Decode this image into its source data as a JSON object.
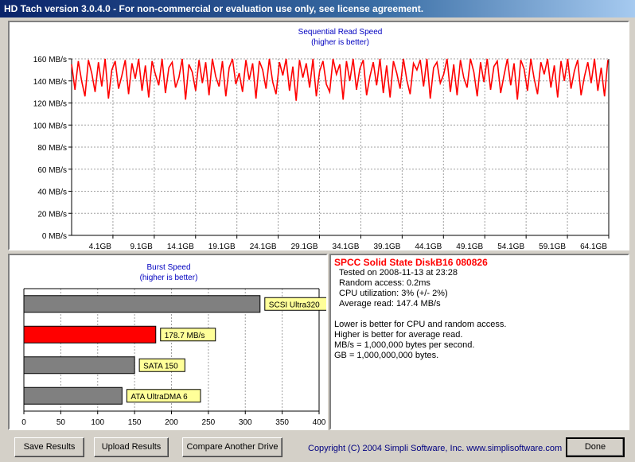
{
  "window": {
    "title": "HD Tach version 3.0.4.0  - For non-commercial or evaluation use only, see license agreement."
  },
  "seq_chart": {
    "title_line1": "Sequential Read Speed",
    "title_line2": "(higher is better)",
    "y_ticks": [
      "0 MB/s",
      "20 MB/s",
      "40 MB/s",
      "60 MB/s",
      "80 MB/s",
      "100 MB/s",
      "120 MB/s",
      "140 MB/s",
      "160 MB/s"
    ],
    "x_ticks": [
      "4.1GB",
      "9.1GB",
      "14.1GB",
      "19.1GB",
      "24.1GB",
      "29.1GB",
      "34.1GB",
      "39.1GB",
      "44.1GB",
      "49.1GB",
      "54.1GB",
      "59.1GB",
      "64.1GB"
    ],
    "line_color": "#ff0000"
  },
  "burst_chart": {
    "title_line1": "Burst Speed",
    "title_line2": "(higher is better)",
    "x_ticks": [
      "0",
      "50",
      "100",
      "150",
      "200",
      "250",
      "300",
      "350",
      "400"
    ]
  },
  "chart_data": [
    {
      "type": "line",
      "title": "Sequential Read Speed",
      "subtitle": "(higher is better)",
      "xlabel": "",
      "ylabel": "",
      "x_unit": "GB",
      "y_unit": "MB/s",
      "xlim": [
        0,
        64.1
      ],
      "ylim": [
        0,
        160
      ],
      "grid": true,
      "series": [
        {
          "x": [
            0,
            0.4,
            0.8,
            1.2,
            1.6,
            2.0,
            2.4,
            2.8,
            3.2,
            3.6,
            4.0,
            4.4,
            4.8,
            5.2,
            5.6,
            6.0,
            6.4,
            6.8,
            7.2,
            7.6,
            8.0,
            8.4,
            8.8,
            9.2,
            9.6,
            10.0,
            10.4,
            10.8,
            11.2,
            11.6,
            12.0,
            12.4,
            12.8,
            13.2,
            13.6,
            14.0,
            14.4,
            14.8,
            15.2,
            15.6,
            16.0,
            16.4,
            16.8,
            17.2,
            17.6,
            18.0,
            18.4,
            18.8,
            19.2,
            19.6,
            20.0,
            20.4,
            20.8,
            21.2,
            21.6,
            22.0,
            22.4,
            22.8,
            23.2,
            23.6,
            24.0,
            24.4,
            24.8,
            25.2,
            25.6,
            26.0,
            26.4,
            26.8,
            27.2,
            27.6,
            28.0,
            28.4,
            28.8,
            29.2,
            29.6,
            30.0,
            30.4,
            30.8,
            31.2,
            31.6,
            32.0,
            32.4,
            32.8,
            33.2,
            33.6,
            34.0,
            34.4,
            34.8,
            35.2,
            35.6,
            36.0,
            36.4,
            36.8,
            37.2,
            37.6,
            38.0,
            38.4,
            38.8,
            39.2,
            39.6,
            40.0,
            40.4,
            40.8,
            41.2,
            41.6,
            42.0,
            42.4,
            42.8,
            43.2,
            43.6,
            44.0,
            44.4,
            44.8,
            45.2,
            45.6,
            46.0,
            46.4,
            46.8,
            47.2,
            47.6,
            48.0,
            48.4,
            48.8,
            49.2,
            49.6,
            50.0,
            50.4,
            50.8,
            51.2,
            51.6,
            52.0,
            52.4,
            52.8,
            53.2,
            53.6,
            54.0,
            54.4,
            54.8,
            55.2,
            55.6,
            56.0,
            56.4,
            56.8,
            57.2,
            57.6,
            58.0,
            58.4,
            58.8,
            59.2,
            59.6,
            60.0,
            60.4,
            60.8,
            61.2,
            61.6,
            62.0,
            62.4,
            62.8,
            63.2,
            63.6,
            64.0
          ],
          "y": [
            155,
            132,
            158,
            140,
            126,
            159,
            147,
            130,
            157,
            135,
            160,
            124,
            150,
            158,
            133,
            145,
            159,
            128,
            156,
            142,
            160,
            131,
            154,
            125,
            158,
            146,
            136,
            160,
            129,
            152,
            157,
            134,
            143,
            160,
            123,
            155,
            148,
            131,
            159,
            138,
            157,
            127,
            160,
            144,
            135,
            158,
            126,
            152,
            160,
            137,
            147,
            130,
            159,
            141,
            156,
            124,
            158,
            150,
            133,
            160,
            139,
            128,
            157,
            145,
            160,
            131,
            153,
            122,
            159,
            143,
            156,
            134,
            160,
            126,
            149,
            158,
            137,
            130,
            160,
            146,
            155,
            123,
            158,
            140,
            160,
            132,
            151,
            159,
            127,
            144,
            157,
            136,
            160,
            129,
            154,
            125,
            158,
            147,
            133,
            160,
            141,
            128,
            156,
            150,
            159,
            135,
            160,
            124,
            152,
            157,
            138,
            146,
            160,
            130,
            155,
            127,
            159,
            143,
            134,
            160,
            148,
            126,
            157,
            139,
            160,
            132,
            153,
            158,
            129,
            145,
            160,
            136,
            156,
            123,
            159,
            151,
            131,
            160,
            142,
            128,
            157,
            146,
            160,
            134,
            154,
            125,
            158,
            140,
            160,
            133,
            149,
            159,
            127,
            144,
            157,
            138,
            160,
            131,
            152,
            126,
            159
          ]
        }
      ]
    },
    {
      "type": "bar",
      "title": "Burst Speed",
      "subtitle": "(higher is better)",
      "xlabel": "",
      "ylabel": "",
      "xlim": [
        0,
        400
      ],
      "categories": [
        "SCSI Ultra320",
        "178.7 MB/s",
        "SATA 150",
        "ATA UltraDMA 6"
      ],
      "values": [
        320,
        178.7,
        150,
        133
      ],
      "colors": [
        "#808080",
        "#ff0000",
        "#808080",
        "#808080"
      ],
      "label_background": "#ffff99"
    }
  ],
  "info": {
    "drive_name": "SPCC Solid State DiskB16 080826",
    "tested_on": "Tested on 2008-11-13 at 23:28",
    "random_access": "Random access: 0.2ms",
    "cpu": "CPU utilization: 3% (+/- 2%)",
    "average_read": "Average read: 147.4 MB/s",
    "note1": "Lower is better for CPU and random access.",
    "note2": "Higher is better for average read.",
    "note3": "MB/s = 1,000,000 bytes per second.",
    "note4": "GB = 1,000,000,000 bytes."
  },
  "buttons": {
    "save_label": "Save Results",
    "upload_label": "Upload Results",
    "compare_label": "Compare Another Drive",
    "done_label": "Done"
  },
  "copyright": "Copyright (C) 2004 Simpli Software, Inc. www.simplisoftware.com"
}
